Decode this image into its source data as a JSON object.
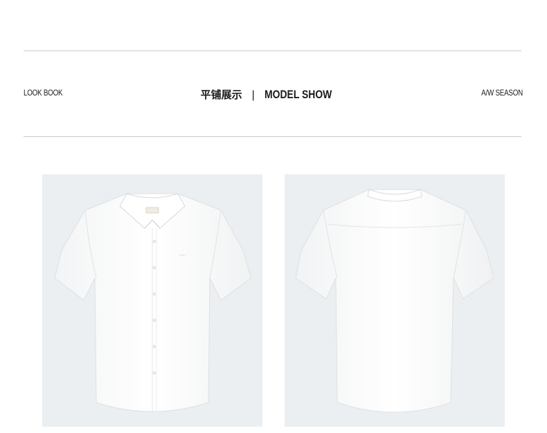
{
  "header": {
    "left_tag": "LOOK BOOK",
    "title_zh": "平铺展示",
    "separator": "|",
    "title_en": "MODEL SHOW",
    "right_tag": "A/W SEASON"
  },
  "products": [
    {
      "icon": "shirt-front-icon"
    },
    {
      "icon": "shirt-back-icon"
    }
  ],
  "colors": {
    "photo_bg": "#eceff1",
    "shirt": "#fbfbfb",
    "rule": "#c8c8c8"
  }
}
